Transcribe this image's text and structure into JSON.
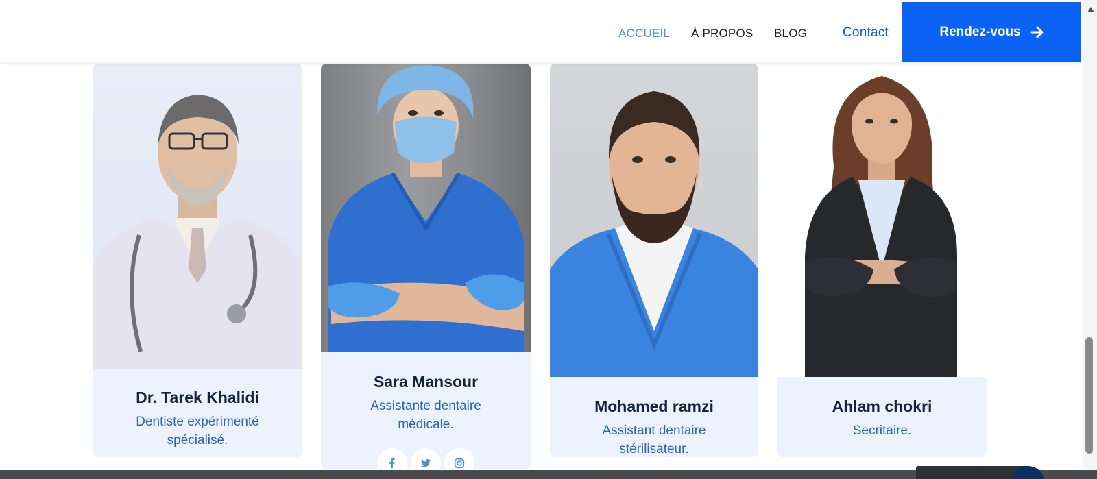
{
  "nav": {
    "links": [
      "ACCUEIL",
      "À PROPOS",
      "BLOG"
    ],
    "contact": "Contact",
    "cta": "Rendez-vous",
    "active_index": 0,
    "accent_color": "#0a63f5"
  },
  "team": [
    {
      "name": "Dr. Tarek Khalidi",
      "role": "Dentiste expérimenté spécialisé.",
      "photo": "doctor-portrait"
    },
    {
      "name": "Sara Mansour",
      "role": "Assistante dentaire médicale.",
      "photo": "nurse-portrait",
      "socials": [
        "facebook-icon",
        "twitter-icon",
        "instagram-icon"
      ]
    },
    {
      "name": "Mohamed ramzi",
      "role": "Assistant dentaire stérilisateur.",
      "photo": "assistant-portrait"
    },
    {
      "name": "Ahlam chokri",
      "role": "Secritaire.",
      "photo": "secretary-portrait"
    }
  ],
  "colors": {
    "card_info_bg": "#edf3fe",
    "name_color": "#14233f",
    "role_color": "#2a63b5"
  }
}
